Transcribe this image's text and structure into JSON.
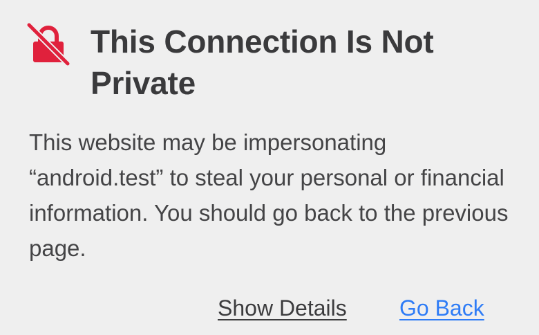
{
  "warning": {
    "icon": "broken-lock-icon",
    "icon_color": "#e0213c",
    "title": "This Connection Is Not Private",
    "message": "This website may be impersonating “android.test” to steal your personal or financial information. You should go back to the previous page."
  },
  "actions": {
    "show_details_label": "Show Details",
    "go_back_label": "Go Back",
    "link_color": "#2e7cf6"
  }
}
